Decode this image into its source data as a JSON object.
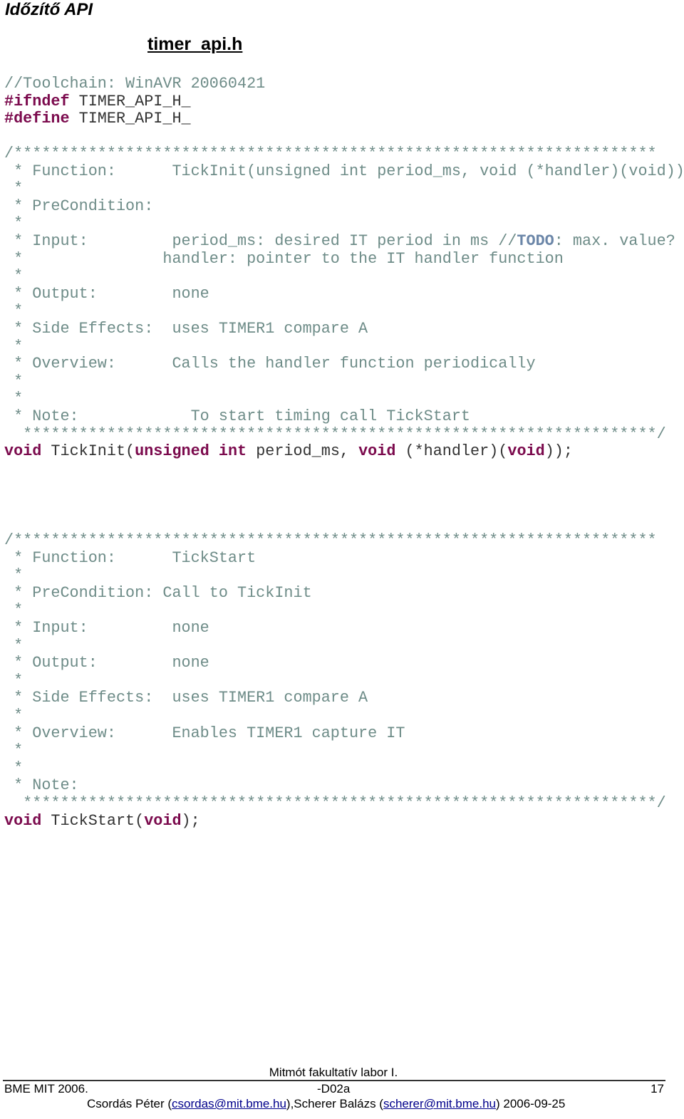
{
  "page": {
    "title": "Időzítő API",
    "file_name": "timer_api.h"
  },
  "colors": {
    "comment": "#6e8c88",
    "keyword": "#7b0a4d",
    "todo": "#6b86a8",
    "text": "#333333"
  },
  "code": {
    "header_lines": [
      [
        {
          "t": "//Toolchain: WinAVR 20060421",
          "c": "cmt"
        }
      ],
      [
        {
          "t": "#ifndef",
          "c": "kw"
        },
        {
          "t": " TIMER_API_H_",
          "c": "plain"
        }
      ],
      [
        {
          "t": "#define",
          "c": "kw"
        },
        {
          "t": " TIMER_API_H_",
          "c": "plain"
        }
      ]
    ],
    "tickinit_lines": [
      [
        {
          "t": "/*********************************************************************",
          "c": "cmt"
        }
      ],
      [
        {
          "t": " * Function:      TickInit(unsigned int period_ms, void (*handler)(void))",
          "c": "cmt"
        }
      ],
      [
        {
          "t": " *",
          "c": "cmt"
        }
      ],
      [
        {
          "t": " * PreCondition:",
          "c": "cmt"
        }
      ],
      [
        {
          "t": " *",
          "c": "cmt"
        }
      ],
      [
        {
          "t": " * Input:         period_ms: desired IT period in ms //",
          "c": "cmt"
        },
        {
          "t": "TODO",
          "c": "todo"
        },
        {
          "t": ": max. value?",
          "c": "cmt"
        }
      ],
      [
        {
          "t": " *               handler: pointer to the IT handler function",
          "c": "cmt"
        }
      ],
      [
        {
          "t": " *",
          "c": "cmt"
        }
      ],
      [
        {
          "t": " * Output:        none",
          "c": "cmt"
        }
      ],
      [
        {
          "t": " *",
          "c": "cmt"
        }
      ],
      [
        {
          "t": " * Side Effects:  uses TIMER1 compare A",
          "c": "cmt"
        }
      ],
      [
        {
          "t": " *",
          "c": "cmt"
        }
      ],
      [
        {
          "t": " * Overview:      Calls the handler function periodically",
          "c": "cmt"
        }
      ],
      [
        {
          "t": " *",
          "c": "cmt"
        }
      ],
      [
        {
          "t": " *",
          "c": "cmt"
        }
      ],
      [
        {
          "t": " * Note:            To start timing call TickStart",
          "c": "cmt"
        }
      ],
      [
        {
          "t": "  ********************************************************************/",
          "c": "cmt"
        }
      ],
      [
        {
          "t": "void",
          "c": "kw"
        },
        {
          "t": " TickInit(",
          "c": "plain"
        },
        {
          "t": "unsigned int",
          "c": "kw"
        },
        {
          "t": " period_ms, ",
          "c": "plain"
        },
        {
          "t": "void",
          "c": "kw"
        },
        {
          "t": " (*handler)(",
          "c": "plain"
        },
        {
          "t": "void",
          "c": "kw"
        },
        {
          "t": "));",
          "c": "plain"
        }
      ]
    ],
    "tickstart_lines": [
      [
        {
          "t": "/*********************************************************************",
          "c": "cmt"
        }
      ],
      [
        {
          "t": " * Function:      TickStart",
          "c": "cmt"
        }
      ],
      [
        {
          "t": " *",
          "c": "cmt"
        }
      ],
      [
        {
          "t": " * PreCondition: Call to TickInit",
          "c": "cmt"
        }
      ],
      [
        {
          "t": " *",
          "c": "cmt"
        }
      ],
      [
        {
          "t": " * Input:         none",
          "c": "cmt"
        }
      ],
      [
        {
          "t": " *",
          "c": "cmt"
        }
      ],
      [
        {
          "t": " * Output:        none",
          "c": "cmt"
        }
      ],
      [
        {
          "t": " *",
          "c": "cmt"
        }
      ],
      [
        {
          "t": " * Side Effects:  uses TIMER1 compare A",
          "c": "cmt"
        }
      ],
      [
        {
          "t": " *",
          "c": "cmt"
        }
      ],
      [
        {
          "t": " * Overview:      Enables TIMER1 capture IT",
          "c": "cmt"
        }
      ],
      [
        {
          "t": " *",
          "c": "cmt"
        }
      ],
      [
        {
          "t": " *",
          "c": "cmt"
        }
      ],
      [
        {
          "t": " * Note:",
          "c": "cmt"
        }
      ],
      [
        {
          "t": "  ********************************************************************/",
          "c": "cmt"
        }
      ],
      [
        {
          "t": "void",
          "c": "kw"
        },
        {
          "t": " TickStart(",
          "c": "plain"
        },
        {
          "t": "void",
          "c": "kw"
        },
        {
          "t": ");",
          "c": "plain"
        }
      ]
    ]
  },
  "footer": {
    "course": "Mitmót fakultatív labor I.",
    "org": "BME MIT 2006.",
    "doc_id": "-D02a",
    "page_number": "17",
    "author1_prefix": "Csordás Péter (",
    "author1_email": "csordas@mit.bme.hu",
    "author_sep": "),Scherer Balázs (",
    "author2_email": "scherer@mit.bme.hu",
    "date_suffix": ")  2006-09-25"
  }
}
